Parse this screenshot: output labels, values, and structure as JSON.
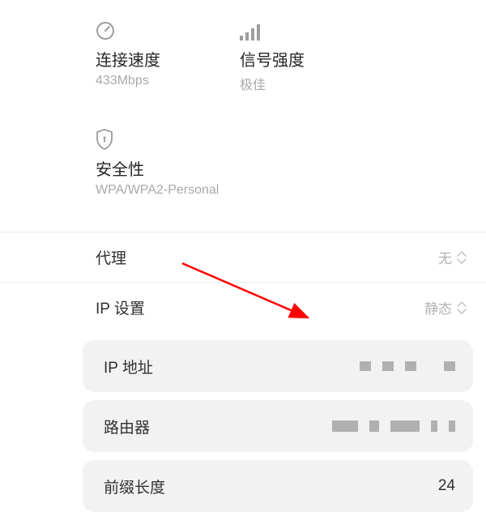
{
  "info": {
    "speed": {
      "label": "连接速度",
      "value": "433Mbps",
      "icon": "speed-gauge-icon"
    },
    "signal": {
      "label": "信号强度",
      "value": "极佳",
      "icon": "signal-bars-icon"
    },
    "security": {
      "label": "安全性",
      "value": "WPA/WPA2-Personal",
      "icon": "shield-icon"
    }
  },
  "rows": {
    "proxy": {
      "label": "代理",
      "value": "无"
    },
    "ip_settings": {
      "label": "IP 设置",
      "value": "静态"
    }
  },
  "fields": {
    "ip_address": {
      "label": "IP 地址",
      "value": ""
    },
    "router": {
      "label": "路由器",
      "value": ""
    },
    "prefix_length": {
      "label": "前缀长度",
      "value": "24"
    }
  },
  "annotation": {
    "arrow_color": "#ff0000"
  }
}
